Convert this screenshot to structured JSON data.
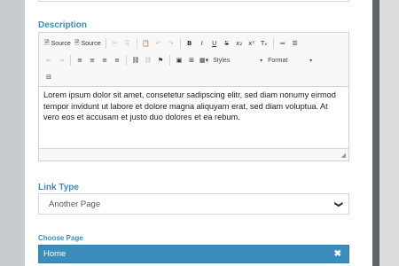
{
  "description": {
    "label": "Description",
    "toolbar": {
      "row1": [
        {
          "name": "source-button-1",
          "glyph": "🗎",
          "text": "Source",
          "dim": false
        },
        {
          "name": "source-button-2",
          "glyph": "🗎",
          "text": "Source",
          "dim": false
        },
        {
          "name": "cut-icon",
          "glyph": "✂",
          "text": "",
          "dim": true
        },
        {
          "name": "copy-icon",
          "glyph": "⎘",
          "text": "",
          "dim": true
        },
        {
          "name": "paste-icon",
          "glyph": "📋",
          "text": "",
          "dim": false
        },
        {
          "name": "undo-icon",
          "glyph": "↶",
          "text": "",
          "dim": true
        },
        {
          "name": "redo-icon",
          "glyph": "↷",
          "text": "",
          "dim": true
        },
        {
          "name": "bold-icon",
          "glyph": "B",
          "text": "",
          "dim": false
        },
        {
          "name": "italic-icon",
          "glyph": "I",
          "text": "",
          "dim": false
        },
        {
          "name": "underline-icon",
          "glyph": "U",
          "text": "",
          "dim": false
        },
        {
          "name": "strikethrough-icon",
          "glyph": "S",
          "text": "",
          "dim": false
        },
        {
          "name": "subscript-icon",
          "glyph": "x₂",
          "text": "",
          "dim": false
        },
        {
          "name": "superscript-icon",
          "glyph": "x²",
          "text": "",
          "dim": false
        },
        {
          "name": "remove-format-icon",
          "glyph": "Tₓ",
          "text": "",
          "dim": false
        },
        {
          "name": "numbered-list-icon",
          "glyph": "≔",
          "text": "",
          "dim": false
        },
        {
          "name": "bulleted-list-icon",
          "glyph": "☰",
          "text": "",
          "dim": false
        }
      ],
      "row2": [
        {
          "name": "outdent-icon",
          "glyph": "⇤",
          "dim": true
        },
        {
          "name": "indent-icon",
          "glyph": "⇥",
          "dim": true
        },
        {
          "name": "align-left-icon",
          "glyph": "≡",
          "dim": false
        },
        {
          "name": "align-center-icon",
          "glyph": "≡",
          "dim": false
        },
        {
          "name": "align-right-icon",
          "glyph": "≡",
          "dim": false
        },
        {
          "name": "justify-icon",
          "glyph": "≡",
          "dim": false
        },
        {
          "name": "link-icon",
          "glyph": "⛓",
          "dim": false
        },
        {
          "name": "unlink-icon",
          "glyph": "⛓",
          "dim": true
        },
        {
          "name": "anchor-flag-icon",
          "glyph": "⚑",
          "dim": false
        },
        {
          "name": "image-icon",
          "glyph": "▣",
          "dim": false
        },
        {
          "name": "table-icon",
          "glyph": "⊞",
          "dim": false
        },
        {
          "name": "insert-dropdown-icon",
          "glyph": "▦▾",
          "dim": false
        }
      ],
      "styles_label": "Styles",
      "format_label": "Format",
      "row3_glyph": "⊟"
    },
    "content": "Lorem ipsum dolor sit amet, consetetur sadipscing elitr, sed diam nonumy eirmod tempor invidunt ut labore et dolore magna aliquyam erat, sed diam voluptua. At vero eos et accusam et justo duo dolores et ea rebum."
  },
  "link_type": {
    "label": "Link Type",
    "value": "Another Page",
    "chevron": "❯"
  },
  "choose_page": {
    "label": "Choose Page",
    "selected": "Home",
    "remove": "✖"
  },
  "colors": {
    "accent": "#3c8dbc",
    "label": "#3c8dbc"
  }
}
